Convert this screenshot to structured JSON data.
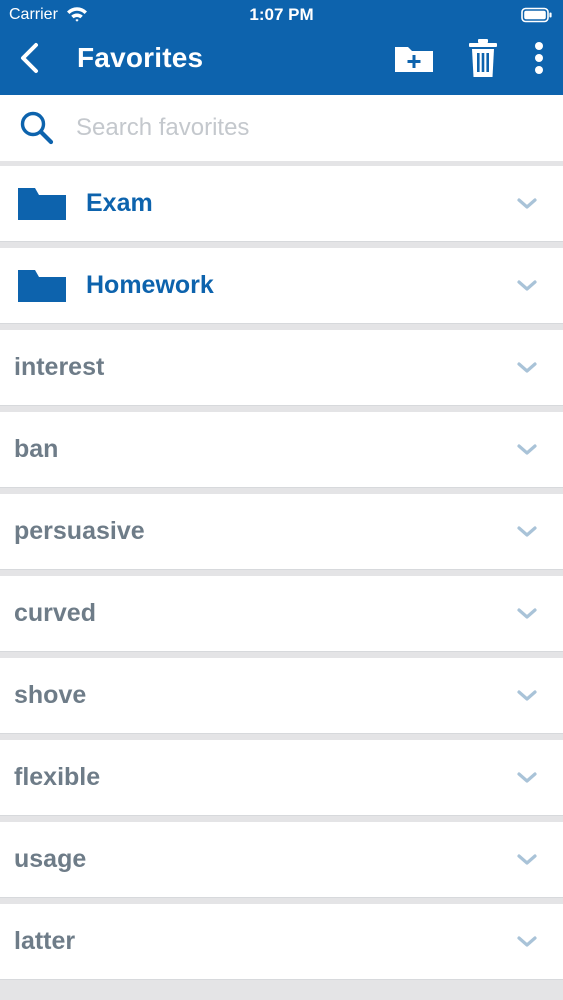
{
  "status": {
    "carrier": "Carrier",
    "time": "1:07 PM"
  },
  "header": {
    "title": "Favorites",
    "back_icon": "chevron-left-icon",
    "actions": [
      "new-folder-icon",
      "trash-icon",
      "more-vertical-icon"
    ]
  },
  "search": {
    "placeholder": "Search favorites",
    "value": ""
  },
  "colors": {
    "brand": "#0d63ad",
    "word_text": "#6e7c88",
    "chevron": "#a9c3d8",
    "placeholder": "#c4c8cd"
  },
  "folders": [
    {
      "label": "Exam"
    },
    {
      "label": "Homework"
    }
  ],
  "words": [
    {
      "label": "interest"
    },
    {
      "label": "ban"
    },
    {
      "label": "persuasive"
    },
    {
      "label": "curved"
    },
    {
      "label": "shove"
    },
    {
      "label": "flexible"
    },
    {
      "label": "usage"
    },
    {
      "label": "latter"
    }
  ]
}
